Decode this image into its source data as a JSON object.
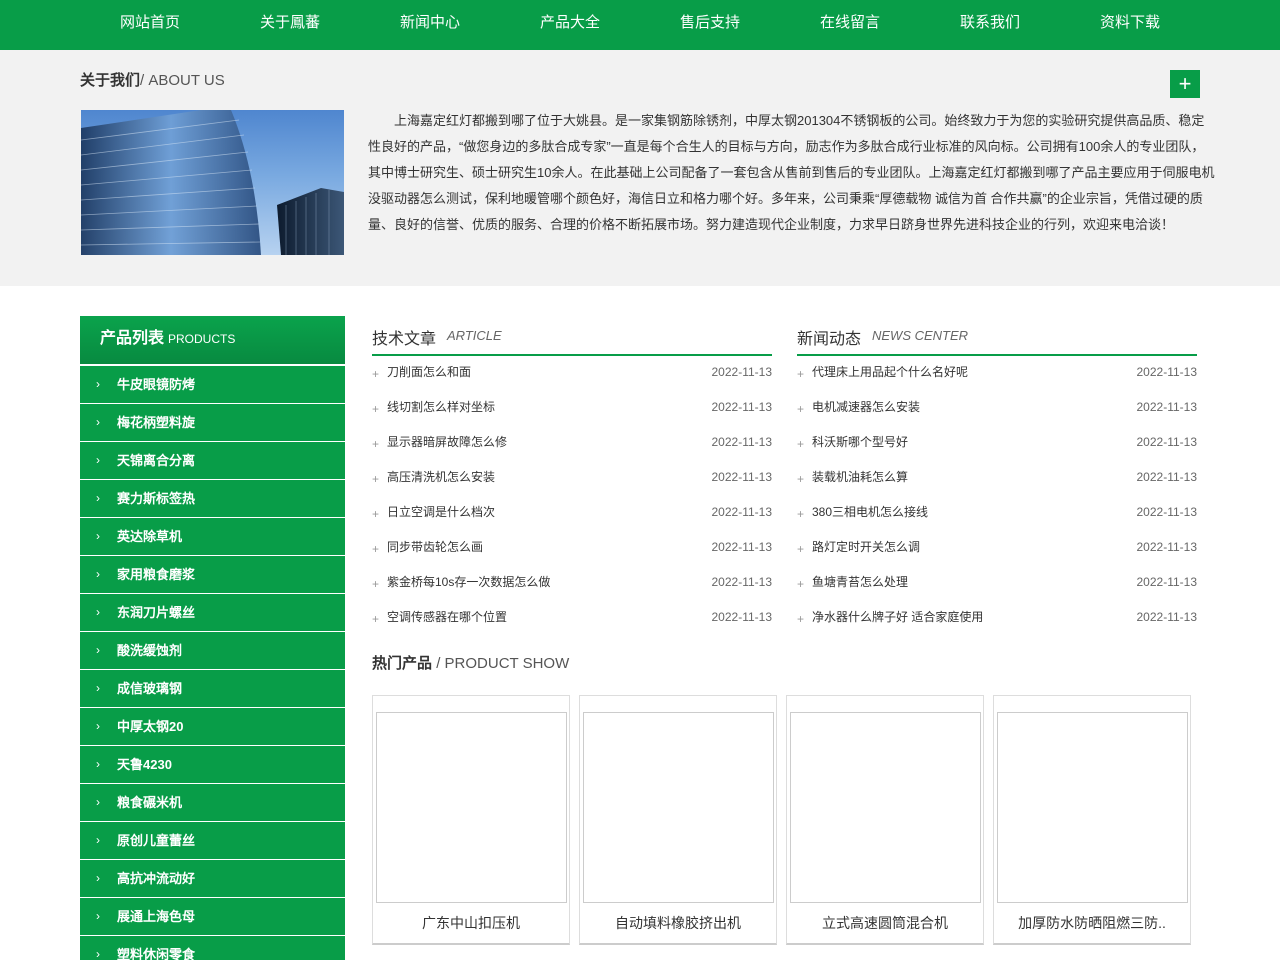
{
  "nav": {
    "items": [
      "网站首页",
      "关于鳳蕃",
      "新闻中心",
      "产品大全",
      "售后支持",
      "在线留言",
      "联系我们",
      "资料下载"
    ]
  },
  "about": {
    "title_cn": "关于我们",
    "title_en": "/ ABOUT US",
    "plus": "+",
    "text": "上海嘉定红灯都搬到哪了位于大姚县。是一家集钢筋除锈剂，中厚太钢201304不锈钢板的公司。始终致力于为您的实验研究提供高品质、稳定性良好的产品，“做您身边的多肽合成专家”一直是每个合生人的目标与方向，励志作为多肽合成行业标准的风向标。公司拥有100余人的专业团队，其中博士研究生、硕士研究生10余人。在此基础上公司配备了一套包含从售前到售后的专业团队。上海嘉定红灯都搬到哪了产品主要应用于伺服电机没驱动器怎么测试，保利地暖管哪个颜色好，海信日立和格力哪个好。多年来，公司秉乘“厚德载物 诚信为首 合作共赢”的企业宗旨，凭借过硬的质量、良好的信誉、优质的服务、合理的价格不断拓展市场。努力建造现代企业制度，力求早日跻身世界先进科技企业的行列，欢迎来电洽谈！"
  },
  "sidebar": {
    "title_cn": "产品列表",
    "title_en": "PRODUCTS",
    "items": [
      "牛皮眼镜防烤",
      "梅花柄塑料旋",
      "天锦离合分离",
      "赛力斯标签热",
      "英达除草机",
      "家用粮食磨浆",
      "东润刀片螺丝",
      "酸洗缓蚀剂",
      "成信玻璃钢",
      "中厚太钢20",
      "天鲁4230",
      "粮食碾米机",
      "原创儿童蕾丝",
      "高抗冲流动好",
      "展通上海色母",
      "塑料休闲零食"
    ]
  },
  "articles": {
    "title_cn": "技术文章",
    "title_en": "ARTICLE",
    "items": [
      {
        "title": "刀削面怎么和面",
        "date": "2022-11-13"
      },
      {
        "title": "线切割怎么样对坐标",
        "date": "2022-11-13"
      },
      {
        "title": "显示器暗屏故障怎么修",
        "date": "2022-11-13"
      },
      {
        "title": "高压清洗机怎么安装",
        "date": "2022-11-13"
      },
      {
        "title": "日立空调是什么档次",
        "date": "2022-11-13"
      },
      {
        "title": "同步带齿轮怎么画",
        "date": "2022-11-13"
      },
      {
        "title": "紫金桥每10s存一次数据怎么做",
        "date": "2022-11-13"
      },
      {
        "title": "空调传感器在哪个位置",
        "date": "2022-11-13"
      }
    ]
  },
  "news": {
    "title_cn": "新闻动态",
    "title_en": "NEWS CENTER",
    "items": [
      {
        "title": "代理床上用品起个什么名好呢",
        "date": "2022-11-13"
      },
      {
        "title": "电机减速器怎么安装",
        "date": "2022-11-13"
      },
      {
        "title": "科沃斯哪个型号好",
        "date": "2022-11-13"
      },
      {
        "title": "装载机油耗怎么算",
        "date": "2022-11-13"
      },
      {
        "title": "380三相电机怎么接线",
        "date": "2022-11-13"
      },
      {
        "title": "路灯定时开关怎么调",
        "date": "2022-11-13"
      },
      {
        "title": "鱼塘青苔怎么处理",
        "date": "2022-11-13"
      },
      {
        "title": "净水器什么牌子好 适合家庭使用",
        "date": "2022-11-13"
      }
    ]
  },
  "hot": {
    "title_cn": "热门产品",
    "title_en": "/ PRODUCT SHOW",
    "items": [
      "广东中山扣压机",
      "自动填料橡胶挤出机",
      "立式高速圆筒混合机",
      "加厚防水防晒阻燃三防.."
    ]
  },
  "icons": {
    "plus": "+",
    "chevron": "›"
  },
  "colors": {
    "brand_green": "#089d48"
  }
}
